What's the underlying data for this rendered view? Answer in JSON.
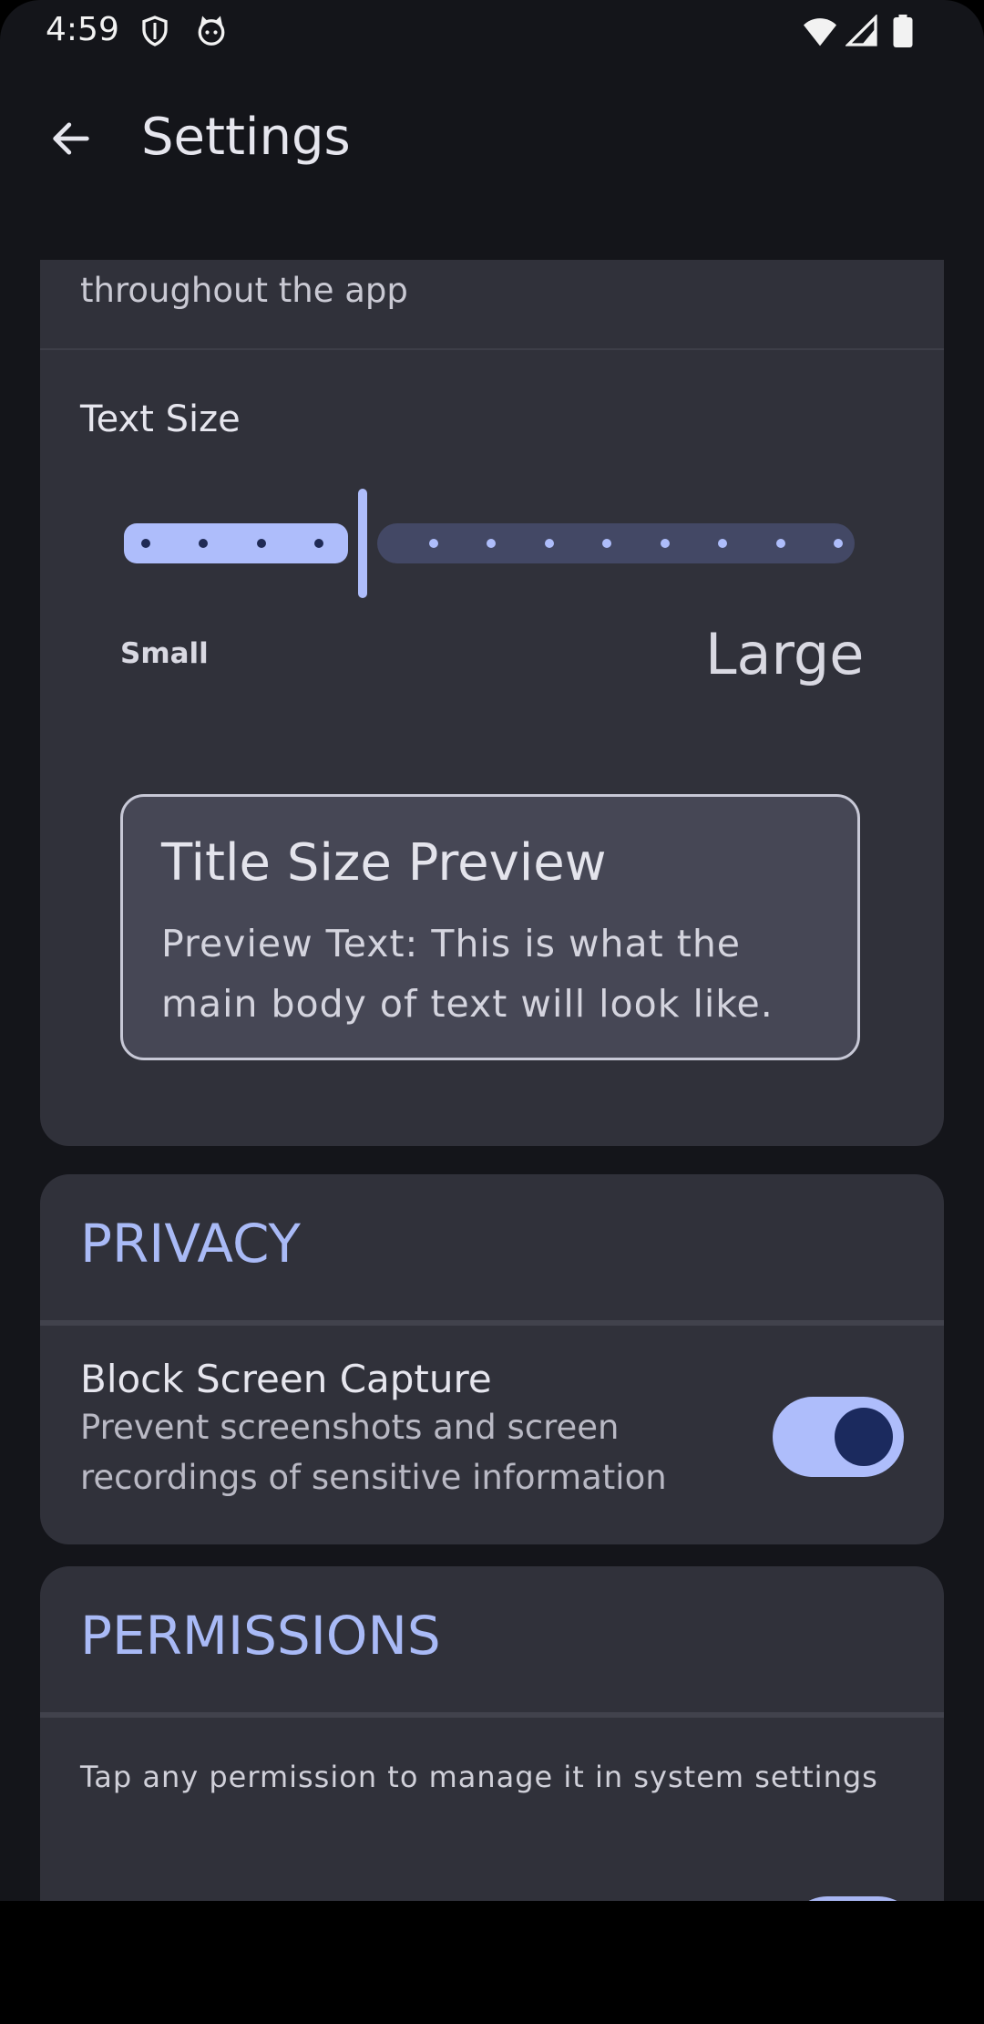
{
  "status_bar": {
    "time": "4:59",
    "left_icons": [
      "shield-icon",
      "cat-icon"
    ],
    "right_icons": [
      "wifi-icon",
      "signal-icon",
      "battery-icon"
    ]
  },
  "app_bar": {
    "title": "Settings",
    "back_icon": "arrow-back-icon"
  },
  "display_section": {
    "cut_off_description": "throughout the app",
    "text_size": {
      "label": "Text Size",
      "slider": {
        "steps": 14,
        "selected_step": 4,
        "min_label": "Small",
        "max_label": "Large"
      },
      "preview": {
        "title": "Title Size Preview",
        "body": "Preview Text:  This is what the main body of text will look like."
      }
    }
  },
  "privacy_section": {
    "header": "PRIVACY",
    "block_screen_capture": {
      "title": "Block Screen Capture",
      "description": "Prevent screenshots and screen recordings of sensitive information",
      "enabled": true
    }
  },
  "permissions_section": {
    "header": "PERMISSIONS",
    "hint": "Tap any permission to manage it in system settings"
  },
  "colors": {
    "background": "#14151a",
    "card": "#30313a",
    "accent": "#aebdfb",
    "section_header": "#a9baf6"
  }
}
